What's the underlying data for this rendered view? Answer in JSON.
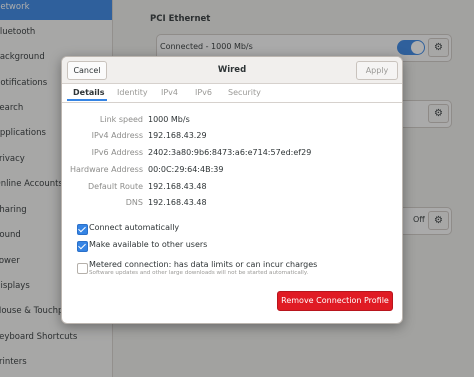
{
  "background": {
    "sidebar": {
      "items": [
        {
          "label": "Network",
          "active": true
        },
        {
          "label": "Bluetooth"
        },
        {
          "label": "Background"
        },
        {
          "label": "Notifications"
        },
        {
          "label": "Search"
        },
        {
          "label": "Applications"
        },
        {
          "label": "Privacy"
        },
        {
          "label": "Online Accounts"
        },
        {
          "label": "Sharing"
        },
        {
          "label": "Sound"
        },
        {
          "label": "Power"
        },
        {
          "label": "Displays"
        },
        {
          "label": "Mouse & Touchpad"
        },
        {
          "label": "Keyboard Shortcuts"
        },
        {
          "label": "Printers"
        }
      ]
    },
    "main": {
      "section_title": "PCI Ethernet",
      "connection_status": "Connected - 1000 Mb/s",
      "proxy_status": "Off"
    }
  },
  "dialog": {
    "title": "Wired",
    "cancel_label": "Cancel",
    "apply_label": "Apply",
    "tabs": [
      "Details",
      "Identity",
      "IPv4",
      "IPv6",
      "Security"
    ],
    "details": [
      {
        "label": "Link speed",
        "value": "1000 Mb/s"
      },
      {
        "label": "IPv4 Address",
        "value": "192.168.43.29"
      },
      {
        "label": "IPv6 Address",
        "value": "2402:3a80:9b6:8473:a6:e714:57ed:ef29"
      },
      {
        "label": "Hardware Address",
        "value": "00:0C:29:64:4B:39"
      },
      {
        "label": "Default Route",
        "value": "192.168.43.48"
      },
      {
        "label": "DNS",
        "value": "192.168.43.48"
      }
    ],
    "checkboxes": [
      {
        "label": "Connect automatically",
        "checked": true
      },
      {
        "label": "Make available to other users",
        "checked": true
      },
      {
        "label": "Metered connection: has data limits or can incur charges",
        "checked": false,
        "sublabel": "Software updates and other large downloads will not be started automatically."
      }
    ],
    "remove_label": "Remove Connection Profile"
  },
  "colors": {
    "accent": "#3584e4",
    "destructive": "#e01b24"
  }
}
